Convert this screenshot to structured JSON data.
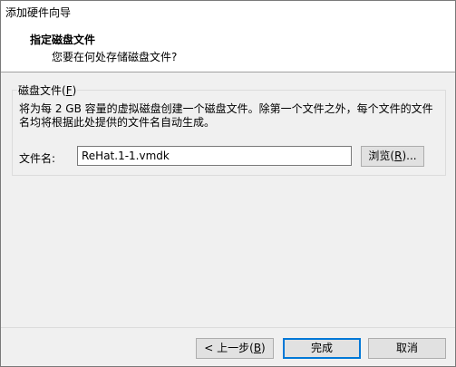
{
  "window": {
    "title": "添加硬件向导"
  },
  "header": {
    "heading": "指定磁盘文件",
    "subheading": "您要在何处存储磁盘文件?"
  },
  "disk_file_group": {
    "legend_text": "磁盘文件(",
    "legend_key": "F",
    "legend_end": ")",
    "description": "将为每 2 GB 容量的虚拟磁盘创建一个磁盘文件。除第一个文件之外，每个文件的文件名均将根据此处提供的文件名自动生成。",
    "filename_label": "文件名:",
    "filename_value": "ReHat.1-1.vmdk",
    "browse_text": "浏览(",
    "browse_key": "R",
    "browse_end": ")..."
  },
  "footer": {
    "back_text": "< 上一步(",
    "back_key": "B",
    "back_end": ")",
    "finish_label": "完成",
    "cancel_label": "取消"
  }
}
